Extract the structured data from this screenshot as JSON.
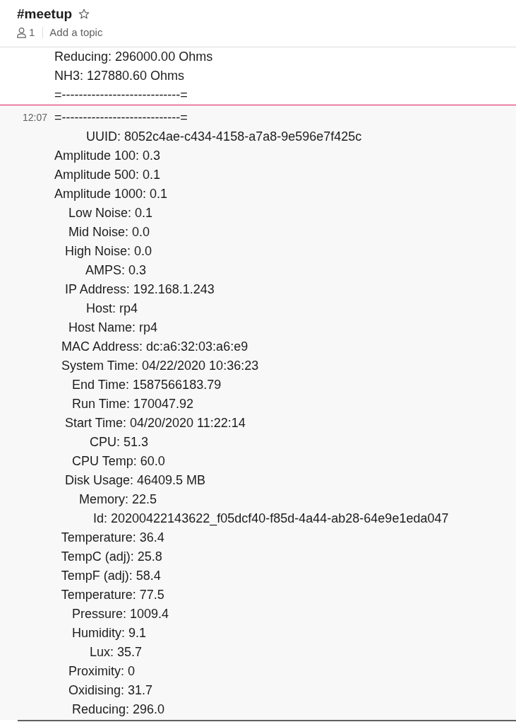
{
  "channel": {
    "name": "#meetup",
    "starred": false,
    "member_count": "1",
    "add_topic_link": "Add a topic"
  },
  "previous_message": {
    "lines": [
      "Reducing: 296000.00 Ohms",
      "NH3: 127880.60 Ohms",
      "=----------------------------="
    ]
  },
  "message": {
    "time": "12:07",
    "lines": [
      "=----------------------------=",
      "         UUID: 8052c4ae-c434-4158-a7a8-9e596e7f425c",
      "Amplitude 100: 0.3",
      "Amplitude 500: 0.1",
      "Amplitude 1000: 0.1",
      "    Low Noise: 0.1",
      "    Mid Noise: 0.0",
      "   High Noise: 0.0",
      "         AMPS: 0.3",
      "   IP Address: 192.168.1.243",
      "         Host: rp4",
      "    Host Name: rp4",
      "  MAC Address: dc:a6:32:03:a6:e9",
      "  System Time: 04/22/2020 10:36:23",
      "     End Time: 1587566183.79",
      "     Run Time: 170047.92",
      "   Start Time: 04/20/2020 11:22:14",
      "          CPU: 51.3",
      "     CPU Temp: 60.0",
      "   Disk Usage: 46409.5 MB",
      "       Memory: 22.5",
      "           Id: 20200422143622_f05dcf40-f85d-4a44-ab28-64e9e1eda047",
      "  Temperature: 36.4",
      "  TempC (adj): 25.8",
      "  TempF (adj): 58.4",
      "  Temperature: 77.5",
      "     Pressure: 1009.4",
      "     Humidity: 9.1",
      "          Lux: 35.7",
      "    Proximity: 0",
      "    Oxidising: 31.7",
      "     Reducing: 296.0"
    ]
  }
}
